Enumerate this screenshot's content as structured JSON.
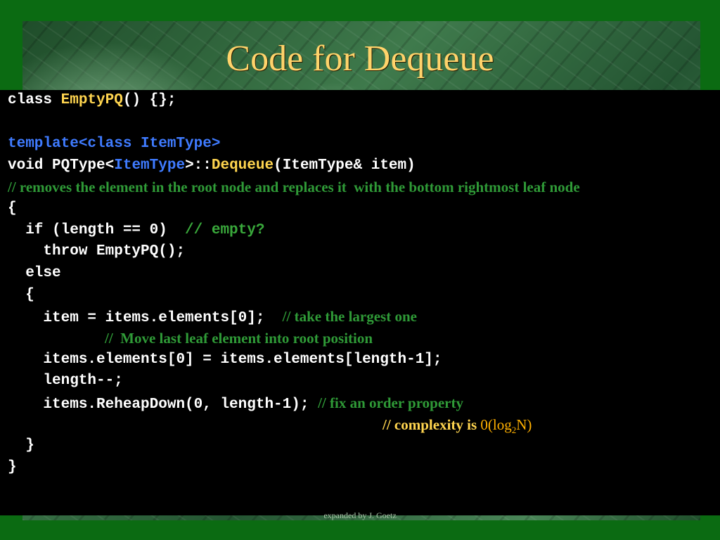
{
  "slide": {
    "title": "Code for Dequeue",
    "footer": "expanded by J. Goetz"
  },
  "code": {
    "l1_class": "class ",
    "l1_name": "EmptyPQ",
    "l1_rest": "() {};",
    "l3_template": "template<class ItemType>",
    "l4_void": "void PQType<",
    "l4_type": "ItemType",
    "l4_scope": ">::",
    "l4_fn": "Dequeue",
    "l4_params": "(ItemType& item)",
    "l5_comment": "// removes the element in the root node and replaces it  with the bottom rightmost leaf node",
    "l6_open": "{",
    "l7_if": "  if (length == 0)  ",
    "l7_comment": "// empty?",
    "l8_throw": "    throw EmptyPQ();",
    "l9_else": "  else",
    "l10_open": "  {",
    "l11_code": "    item = items.elements[0];  ",
    "l11_comment": "// take the largest one",
    "l12_comment": "//  Move last leaf element into root position",
    "l13_code": "    items.elements[0] = items.elements[length-1];",
    "l14_code": "    length--;",
    "l15_code": "    items.ReheapDown(0, length-1); ",
    "l15_comment": "// fix an order property",
    "l16_slash": "// ",
    "l16_label": "complexity is ",
    "l16_value_pre": "0(log",
    "l16_sub": "2",
    "l16_value_post": "N)",
    "l17_close": "  }",
    "l18_close": "}"
  }
}
